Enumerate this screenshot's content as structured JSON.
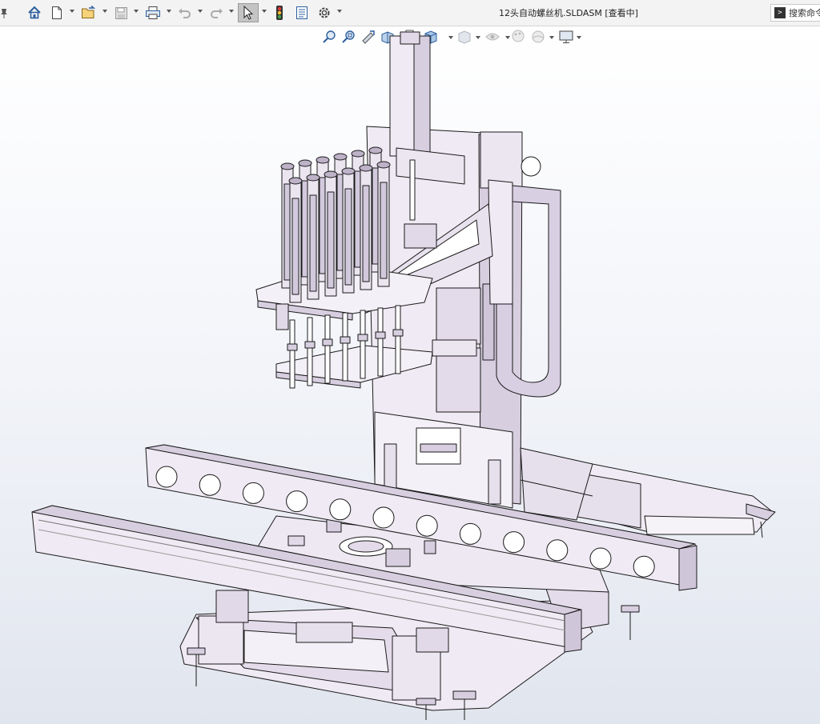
{
  "window": {
    "title": "12头自动螺丝机.SLDASM [查看中]"
  },
  "toolbar": {
    "items": [
      {
        "name": "home-icon",
        "has_dropdown": false
      },
      {
        "name": "new-document-icon",
        "has_dropdown": true
      },
      {
        "name": "open-file-icon",
        "has_dropdown": true
      },
      {
        "name": "save-icon",
        "has_dropdown": true
      },
      {
        "name": "print-icon",
        "has_dropdown": true
      },
      {
        "name": "undo-icon",
        "has_dropdown": true
      },
      {
        "name": "redo-icon",
        "has_dropdown": true
      },
      {
        "name": "select-pointer-icon",
        "has_dropdown": true,
        "active": true
      },
      {
        "name": "rebuild-traffic-light-icon",
        "has_dropdown": false
      },
      {
        "name": "file-properties-icon",
        "has_dropdown": false
      },
      {
        "name": "options-gear-icon",
        "has_dropdown": true
      }
    ]
  },
  "search": {
    "label": "搜索命令"
  },
  "heads_up_toolbar": {
    "items": [
      "zoom-to-fit-icon",
      "zoom-to-area-icon",
      "previous-view-icon",
      "section-view-icon",
      "dynamic-annotation-icon",
      "view-orientation-icon",
      "display-style-icon",
      "hide-show-items-icon",
      "edit-appearance-icon",
      "apply-scene-icon",
      "view-settings-icon"
    ]
  },
  "colors": {
    "part_fill": "#efeaf3",
    "part_fill_dark": "#d7cfe0",
    "outline": "#1a1a1a",
    "accent_purple": "#b9a6c9"
  }
}
